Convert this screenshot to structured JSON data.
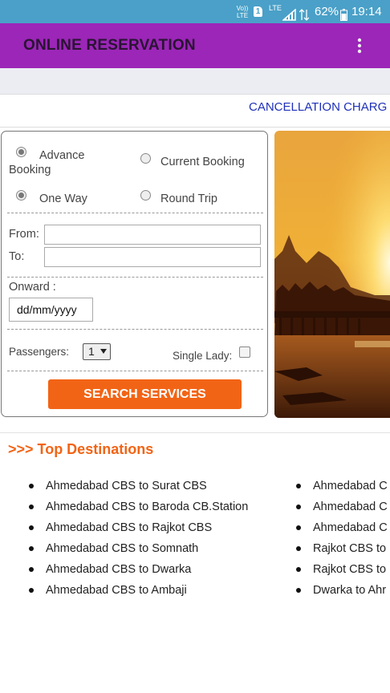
{
  "status_bar": {
    "volte": "Vo)) LTE",
    "sim_badge": "1",
    "network": "LTE",
    "battery_percent": "62%",
    "time": "19:14",
    "icons": [
      "volte-icon",
      "sim-icon",
      "signal-icon",
      "battery-icon"
    ]
  },
  "app_bar": {
    "title": "ONLINE RESERVATION",
    "menu_icon": "more-vert-icon"
  },
  "ticker": {
    "text": "CANCELLATION CHARG"
  },
  "form": {
    "booking_types": [
      {
        "label": "Advance Booking",
        "selected": true
      },
      {
        "label": "Current Booking",
        "selected": false
      }
    ],
    "trip_types": [
      {
        "label": "One Way",
        "selected": true
      },
      {
        "label": "Round Trip",
        "selected": false
      }
    ],
    "from_label": "From:",
    "from_value": "",
    "to_label": "To:",
    "to_value": "",
    "onward_label": "Onward :",
    "date_placeholder": "dd/mm/yyyy",
    "passengers_label": "Passengers:",
    "passengers_value": "1",
    "single_lady_label": "Single Lady:",
    "single_lady_checked": false,
    "search_label": "SEARCH SERVICES"
  },
  "top_destinations": {
    "heading": ">>> Top Destinations",
    "left_column": [
      "Ahmedabad CBS to Surat CBS",
      "Ahmedabad CBS to Baroda CB.Station",
      "Ahmedabad CBS to Rajkot CBS",
      "Ahmedabad CBS to Somnath",
      "Ahmedabad CBS to Dwarka",
      "Ahmedabad CBS to Ambaji"
    ],
    "right_column": [
      "Ahmedabad C",
      "Ahmedabad C",
      "Ahmedabad C",
      "Rajkot CBS to",
      "Rajkot CBS to",
      "Dwarka to Ahr"
    ]
  },
  "colors": {
    "status_bar": "#4aa0c8",
    "app_bar": "#9b26b7",
    "accent": "#f26415",
    "ticker_text": "#1f31b8"
  }
}
